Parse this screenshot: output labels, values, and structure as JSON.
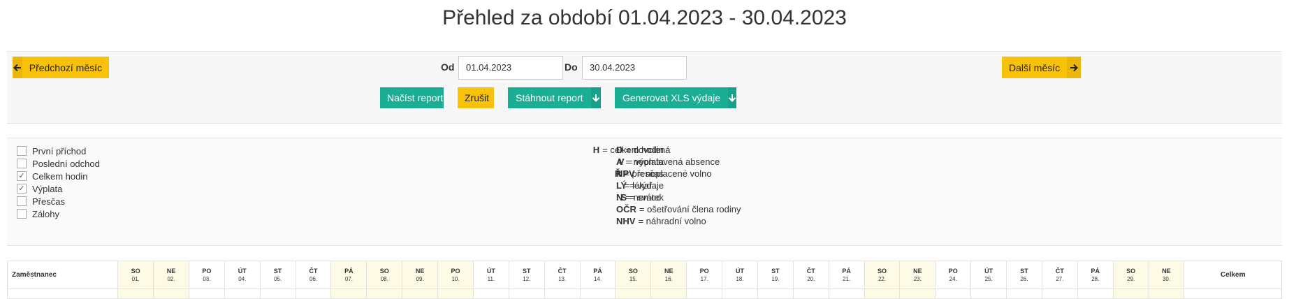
{
  "page_title": "Přehled za období 01.04.2023 - 30.04.2023",
  "filter": {
    "prev_month_label": "Předchozí měsíc",
    "next_month_label": "Další měsíc",
    "from_label": "Od",
    "from_value": "01.04.2023",
    "to_label": "Do",
    "to_value": "30.04.2023",
    "load_label": "Načíst report",
    "cancel_label": "Zrušit",
    "download_label": "Stáhnout report",
    "xls_label": "Generovat XLS výdaje"
  },
  "options": [
    {
      "label": "První příchod",
      "checked": false
    },
    {
      "label": "Poslední odchod",
      "checked": false
    },
    {
      "label": "Celkem hodin",
      "checked": true
    },
    {
      "label": "Výplata",
      "checked": true
    },
    {
      "label": "Přesčas",
      "checked": false
    },
    {
      "label": "Zálohy",
      "checked": false
    }
  ],
  "legend_left": [
    {
      "key": "H",
      "text": "= celkem hodin"
    },
    {
      "key": "V",
      "text": "= výplata"
    },
    {
      "key": "Ř",
      "text": "= přesčas"
    },
    {
      "key": "Ý",
      "text": "= výdaje"
    },
    {
      "key": "S",
      "text": "= svátek"
    }
  ],
  "legend_right": [
    {
      "key": "D",
      "text": "= dovolená"
    },
    {
      "key": "A",
      "text": "= neomluvená absence"
    },
    {
      "key": "NPV",
      "text": "= neplacené volno"
    },
    {
      "key": "L",
      "text": "= lékař"
    },
    {
      "key": "N",
      "text": "= nemoc"
    },
    {
      "key": "OČR",
      "text": "= ošetřování člena rodiny"
    },
    {
      "key": "NHV",
      "text": "= náhradní volno"
    }
  ],
  "table": {
    "employee_header": "Zaměstnanec",
    "total_header": "Celkem",
    "days": [
      {
        "name": "SO",
        "num": "01.",
        "weekend": true
      },
      {
        "name": "NE",
        "num": "02.",
        "weekend": true
      },
      {
        "name": "PO",
        "num": "03.",
        "weekend": false
      },
      {
        "name": "ÚT",
        "num": "04.",
        "weekend": false
      },
      {
        "name": "ST",
        "num": "05.",
        "weekend": false
      },
      {
        "name": "ČT",
        "num": "06.",
        "weekend": false
      },
      {
        "name": "PÁ",
        "num": "07.",
        "weekend": true
      },
      {
        "name": "SO",
        "num": "08.",
        "weekend": true
      },
      {
        "name": "NE",
        "num": "09.",
        "weekend": true
      },
      {
        "name": "PO",
        "num": "10.",
        "weekend": true
      },
      {
        "name": "ÚT",
        "num": "11.",
        "weekend": false
      },
      {
        "name": "ST",
        "num": "12.",
        "weekend": false
      },
      {
        "name": "ČT",
        "num": "13.",
        "weekend": false
      },
      {
        "name": "PÁ",
        "num": "14.",
        "weekend": false
      },
      {
        "name": "SO",
        "num": "15.",
        "weekend": true
      },
      {
        "name": "NE",
        "num": "16.",
        "weekend": true
      },
      {
        "name": "PO",
        "num": "17.",
        "weekend": false
      },
      {
        "name": "ÚT",
        "num": "18.",
        "weekend": false
      },
      {
        "name": "ST",
        "num": "19.",
        "weekend": false
      },
      {
        "name": "ČT",
        "num": "20.",
        "weekend": false
      },
      {
        "name": "PÁ",
        "num": "21.",
        "weekend": false
      },
      {
        "name": "SO",
        "num": "22.",
        "weekend": true
      },
      {
        "name": "NE",
        "num": "23.",
        "weekend": true
      },
      {
        "name": "PO",
        "num": "24.",
        "weekend": false
      },
      {
        "name": "ÚT",
        "num": "25.",
        "weekend": false
      },
      {
        "name": "ST",
        "num": "26.",
        "weekend": false
      },
      {
        "name": "ČT",
        "num": "27.",
        "weekend": false
      },
      {
        "name": "PÁ",
        "num": "28.",
        "weekend": false
      },
      {
        "name": "SO",
        "num": "29.",
        "weekend": true
      },
      {
        "name": "NE",
        "num": "30.",
        "weekend": true
      }
    ]
  },
  "colors": {
    "accent_yellow": "#f8c20a",
    "accent_teal": "#1aae95",
    "weekend_bg": "#fdfbe6"
  }
}
